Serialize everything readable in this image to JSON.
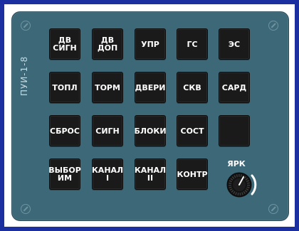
{
  "panel": {
    "label": "ПУИ-1-8",
    "colors": {
      "frame": "#1c2fa0",
      "panel": "#3d6878",
      "button": "#1a1a1a",
      "text": "#ffffff"
    }
  },
  "buttons": [
    {
      "label": "ДВ\nСИГН"
    },
    {
      "label": "ДВ\nДОП"
    },
    {
      "label": "УПР"
    },
    {
      "label": "ГС"
    },
    {
      "label": "ЭС"
    },
    {
      "label": "ТОПЛ"
    },
    {
      "label": "ТОРМ"
    },
    {
      "label": "ДВЕРИ"
    },
    {
      "label": "СКВ"
    },
    {
      "label": "САРД"
    },
    {
      "label": "СБРОС"
    },
    {
      "label": "СИГН"
    },
    {
      "label": "БЛОКИ"
    },
    {
      "label": "СОСТ"
    },
    {
      "label": ""
    },
    {
      "label": "ВЫБОР\nИМ"
    },
    {
      "label": "КАНАЛ\nI"
    },
    {
      "label": "КАНАЛ\nII"
    },
    {
      "label": "КОНТР"
    }
  ],
  "knob": {
    "label": "ЯРК",
    "icon": "brightness-knob-icon"
  }
}
